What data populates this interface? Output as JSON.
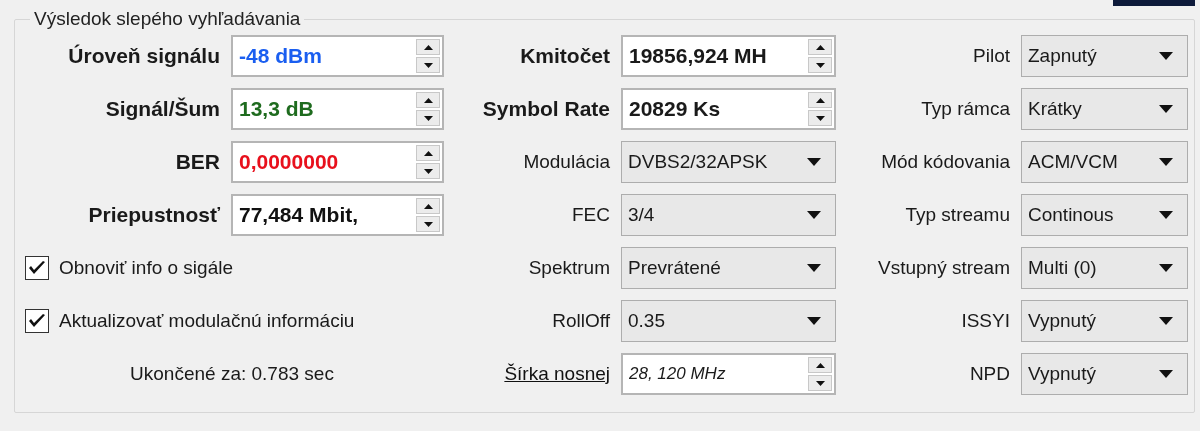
{
  "group": {
    "title": "Výsledok slepého vyhľadávania"
  },
  "signal_fields": [
    {
      "label": "Úroveň signálu",
      "value": "-48 dBm",
      "color": "#1a5ef0"
    },
    {
      "label": "Signál/Šum",
      "value": "13,3 dB",
      "color": "#1e6b1e"
    },
    {
      "label": "BER",
      "value": "0,0000000",
      "color": "#e8101c"
    },
    {
      "label": "Priepustnosť",
      "value": "77,484 Mbit,",
      "color": "#111111"
    }
  ],
  "checkboxes": [
    {
      "label": "Obnoviť info o sigále",
      "checked": true
    },
    {
      "label": "Aktualizovať modulačnú informáciu",
      "checked": true
    }
  ],
  "elapsed": "Ukončené za: 0.783 sec",
  "tuning_fields": [
    {
      "kind": "spinbox",
      "label": "Kmitočet",
      "value": "19856,924 MH"
    },
    {
      "kind": "spinbox",
      "label": "Symbol Rate",
      "value": "20829 Ks"
    },
    {
      "kind": "dropdown",
      "label": "Modulácia",
      "value": "DVBS2/32APSK"
    },
    {
      "kind": "dropdown",
      "label": "FEC",
      "value": "3/4"
    },
    {
      "kind": "dropdown",
      "label": "Spektrum",
      "value": "Prevrátené"
    },
    {
      "kind": "dropdown",
      "label": "RollOff",
      "value": "0.35"
    },
    {
      "kind": "linked",
      "label": "Šírka nosnej",
      "value": "28, 120 MHz"
    }
  ],
  "stream_fields": [
    {
      "label": "Pilot",
      "value": "Zapnutý"
    },
    {
      "label": "Typ rámca",
      "value": "Krátky"
    },
    {
      "label": "Mód kódovania",
      "value": "ACM/VCM"
    },
    {
      "label": "Typ streamu",
      "value": "Continous"
    },
    {
      "label": "Vstupný stream",
      "value": "Multi (0)"
    },
    {
      "label": "ISSYI",
      "value": "Vypnutý"
    },
    {
      "label": "NPD",
      "value": "Vypnutý"
    }
  ]
}
